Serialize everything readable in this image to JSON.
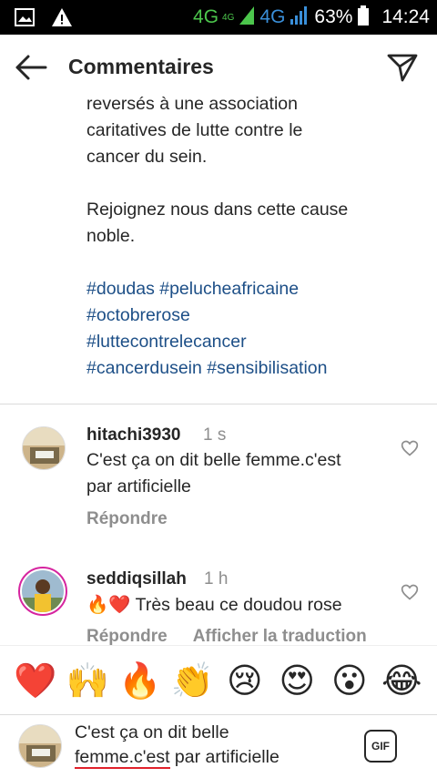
{
  "status_bar": {
    "network_1": "4G",
    "network_1_sup": "4G",
    "network_2": "4G",
    "battery": "63%",
    "time": "14:24"
  },
  "header": {
    "title": "Commentaires"
  },
  "caption": {
    "lines_1": [
      "reversés à une association",
      "caritatives de lutte contre le",
      "cancer du sein."
    ],
    "lines_2": [
      "Rejoignez nous dans cette cause",
      "noble."
    ],
    "hashtags": [
      "#doudas #pelucheafricaine",
      "#octobrerose",
      "#luttecontrelecancer",
      "#cancerdusein #sensibilisation"
    ]
  },
  "comments": [
    {
      "username": "hitachi3930",
      "time": "1 s",
      "text_lines": [
        "C'est ça on dit belle femme.c'est",
        "par artificielle"
      ],
      "reply": "Répondre"
    },
    {
      "username": "seddiqsillah",
      "time": "1 h",
      "text": "Très beau ce doudou rose",
      "emoji_prefix": "🔥❤️",
      "reply": "Répondre",
      "translate": "Afficher la traduction"
    }
  ],
  "emoji_bar": [
    "❤️",
    "🙌",
    "🔥",
    "👏",
    "😢",
    "😍",
    "😮",
    "😂"
  ],
  "composer": {
    "line_1": "C'est ça on dit belle",
    "line_2_underlined": "femme.c'est",
    "line_2_rest": " par artificielle",
    "gif_label": "GIF"
  },
  "colors": {
    "hashtag": "#1d4f87",
    "muted": "#8e8e8e",
    "story_ring": "#d6249f"
  }
}
